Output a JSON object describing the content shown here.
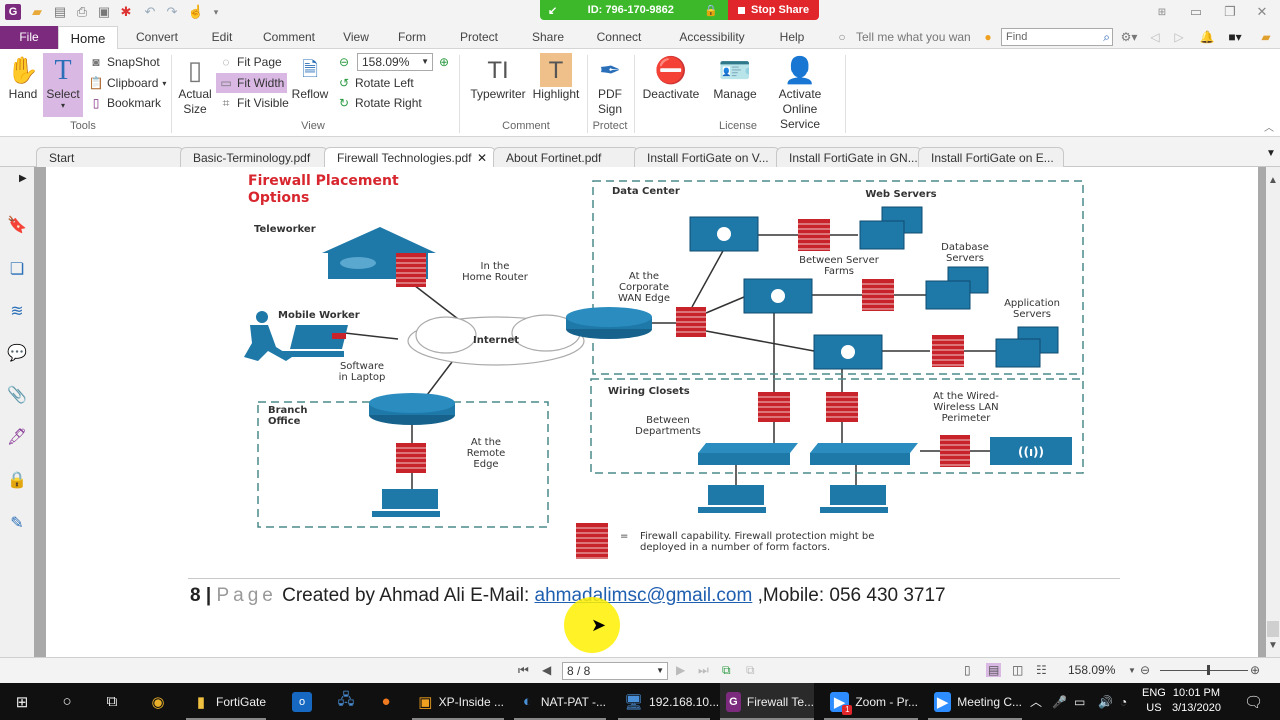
{
  "colors": {
    "brand_purple": "#7b2a7e",
    "share_green": "#3cb82a",
    "stop_red": "#e0262a",
    "firewall_red": "#c8232b",
    "network_blue": "#1e78a8",
    "title_red": "#d8262e",
    "link_blue": "#1f5fb0"
  },
  "titlebar": {
    "share_session_id": "ID: 796-170-9862",
    "stop_share_label": "Stop Share"
  },
  "menu": {
    "tabs": [
      "File",
      "Home",
      "Convert",
      "Edit",
      "Comment",
      "View",
      "Form",
      "Protect",
      "Share",
      "Connect",
      "Accessibility",
      "Help"
    ],
    "tell_me_placeholder": "Tell me what you wan",
    "find_placeholder": "Find"
  },
  "ribbon": {
    "tools": {
      "hand": "Hand",
      "select": "Select",
      "snapshot": "SnapShot",
      "clipboard": "Clipboard",
      "bookmark": "Bookmark",
      "group_label": "Tools"
    },
    "view": {
      "actual_size_1": "Actual",
      "actual_size_2": "Size",
      "fit_page": "Fit Page",
      "fit_width": "Fit Width",
      "fit_visible": "Fit Visible",
      "reflow": "Reflow",
      "zoom_value": "158.09%",
      "rotate_left": "Rotate Left",
      "rotate_right": "Rotate Right",
      "group_label": "View"
    },
    "comment": {
      "typewriter": "Typewriter",
      "highlight": "Highlight",
      "group_label": "Comment"
    },
    "protect": {
      "pdf_sign_1": "PDF",
      "pdf_sign_2": "Sign",
      "group_label": "Protect"
    },
    "license": {
      "deactivate": "Deactivate",
      "manage": "Manage",
      "activate_1": "Activate",
      "activate_2": "Online Service",
      "group_label": "License"
    }
  },
  "doc_tabs": [
    {
      "label": "Start",
      "active": false
    },
    {
      "label": "Basic-Terminology.pdf",
      "active": false
    },
    {
      "label": "Firewall Technologies.pdf",
      "active": true
    },
    {
      "label": "About Fortinet.pdf",
      "active": false
    },
    {
      "label": "Install FortiGate on V...",
      "active": false
    },
    {
      "label": "Install FortiGate in GN...",
      "active": false
    },
    {
      "label": "Install FortiGate on E...",
      "active": false
    }
  ],
  "sidebar_icons": [
    "bookmarks-icon",
    "pages-icon",
    "layers-icon",
    "comments-icon",
    "attachments-icon",
    "signatures-icon",
    "security-icon",
    "digital-id-icon"
  ],
  "diagram": {
    "title_1": "Firewall Placement",
    "title_2": "Options",
    "teleworker": "Teleworker",
    "home_router_1": "In the",
    "home_router_2": "Home Router",
    "mobile_worker": "Mobile Worker",
    "software_1": "Software",
    "software_2": "in Laptop",
    "internet": "Internet",
    "branch_1": "Branch",
    "branch_2": "Office",
    "remote_1": "At the",
    "remote_2": "Remote",
    "remote_3": "Edge",
    "data_center": "Data Center",
    "web_servers": "Web Servers",
    "between_farms_1": "Between Server",
    "between_farms_2": "Farms",
    "database_1": "Database",
    "database_2": "Servers",
    "wan_edge_1": "At the",
    "wan_edge_2": "Corporate",
    "wan_edge_3": "WAN Edge",
    "application_1": "Application",
    "application_2": "Servers",
    "wiring_closets": "Wiring Closets",
    "between_depts_1": "Between",
    "between_depts_2": "Departments",
    "wireless_1": "At the Wired-",
    "wireless_2": "Wireless LAN",
    "wireless_3": "Perimeter",
    "legend_eq": "=",
    "legend_1": "Firewall capability. Firewall protection might be",
    "legend_2": "deployed in a number of form factors."
  },
  "footer": {
    "page_num": "8 |",
    "page_word": "Page",
    "created_by": "Created by Ahmad Ali E-Mail:",
    "email": "ahmadalimsc@gmail.com",
    "mobile": ",Mobile: 056 430 3717"
  },
  "statusbar": {
    "page_indicator": "8 / 8",
    "zoom": "158.09%",
    "zoom_slider_fraction": 0.55
  },
  "taskbar": {
    "items": [
      {
        "label": "FortiGate",
        "icon": "folder-icon"
      },
      {
        "label": "XP-Inside ...",
        "icon": "vmware-icon"
      },
      {
        "label": "NAT-PAT -...",
        "icon": "gns3-icon"
      },
      {
        "label": "192.168.10...",
        "icon": "network-icon"
      },
      {
        "label": "Firewall Te...",
        "icon": "pdf-reader-icon"
      },
      {
        "label": "Zoom - Pr...",
        "icon": "zoom-icon",
        "badge": "1"
      },
      {
        "label": "Meeting C...",
        "icon": "zoom-meeting-icon"
      }
    ],
    "lang_1": "ENG",
    "lang_2": "US",
    "time": "10:01 PM",
    "date": "3/13/2020"
  }
}
